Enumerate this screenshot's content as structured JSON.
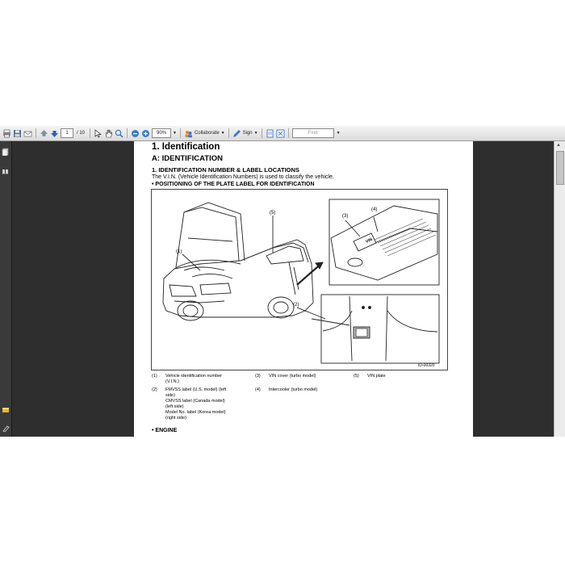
{
  "toolbar": {
    "page_current": "1",
    "page_total": "/ 10",
    "zoom": "90%",
    "collaborate_label": "Collaborate",
    "sign_label": "Sign",
    "find_placeholder": "Find",
    "icons": [
      "print-icon",
      "save-icon",
      "email-icon",
      "prev-page-icon",
      "next-page-icon",
      "select-tool-icon",
      "hand-tool-icon",
      "zoom-tool-icon",
      "zoom-out-icon",
      "zoom-in-icon",
      "collaborate-icon",
      "sign-icon",
      "fit-page-icon",
      "fullscreen-icon"
    ]
  },
  "left_panel": {
    "icons": [
      "pages-icon",
      "bookmarks-icon",
      "attachments-icon",
      "signatures-icon"
    ]
  },
  "document": {
    "h1": "1.  Identification",
    "h2": "A:  IDENTIFICATION",
    "h3": "1.  IDENTIFICATION NUMBER & LABEL LOCATIONS",
    "para": "The V.I.N. (Vehicle Identification Numbers) is used to classify the vehicle.",
    "bullet1": "•  POSITIONING OF THE PLATE LABEL FOR IDENTIFICATION",
    "bullet2": "•  ENGINE",
    "figure": {
      "callouts": [
        "(1)",
        "(2)",
        "(3)",
        "(4)",
        "(5)"
      ],
      "plate_text": "VIN",
      "figure_id": "ID-00320"
    },
    "legend": {
      "col1": [
        {
          "num": "(1)",
          "lines": [
            "Vehicle identification number",
            "(V.I.N.)"
          ]
        },
        {
          "num": "(2)",
          "lines": [
            "FMVSS label (U.S. model) (left",
            "side)",
            "CMVSS label (Canada model)",
            "(left side)",
            "Model No. label (Korea model)",
            "(right side)"
          ]
        }
      ],
      "col2": [
        {
          "num": "(3)",
          "lines": [
            "VIN cover (turbo model)"
          ]
        },
        {
          "num": "(4)",
          "lines": [
            "Intercooler (turbo model)"
          ]
        }
      ],
      "col3": [
        {
          "num": "(5)",
          "lines": [
            "VIN plate"
          ]
        }
      ]
    }
  },
  "colors": {
    "background": "#2b2b2b",
    "page": "#ffffff",
    "toolbar": "#e6e6e6",
    "accent": "#2a64b8"
  }
}
